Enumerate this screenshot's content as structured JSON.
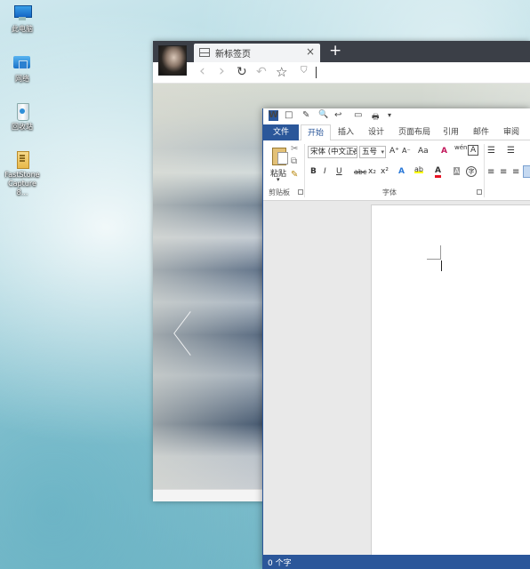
{
  "desktop": {
    "icons": [
      {
        "label": "此电脑",
        "icon": "this-pc-icon"
      },
      {
        "label": "网络",
        "icon": "network-icon"
      },
      {
        "label": "回收站",
        "icon": "recycle-bin-icon"
      },
      {
        "label": "FastStone Capture 8...",
        "icon": "faststone-capture-icon"
      }
    ]
  },
  "browser": {
    "tab_title": "新标签页",
    "tab_close": "×",
    "new_tab": "+",
    "nav": {
      "back": "‹",
      "forward": "›",
      "reload": "↻",
      "undo": "↶",
      "favorite": "☆"
    },
    "address_value": "",
    "slider_prev": "‹"
  },
  "word": {
    "quick_access": [
      "W",
      "□",
      "✎",
      "🔍",
      "↩",
      "▭",
      "🖶",
      "▾"
    ],
    "tabs": [
      "文件",
      "开始",
      "插入",
      "设计",
      "页面布局",
      "引用",
      "邮件",
      "审阅"
    ],
    "active_tab": "开始",
    "clipboard": {
      "paste_label": "粘贴",
      "group_label": "剪贴板"
    },
    "font": {
      "font_name": "宋体 (中文正文)",
      "font_size": "五号",
      "group_label": "字体",
      "buttons": {
        "grow": "A⁺",
        "shrink": "A⁻",
        "case": "Aa",
        "clear": "A",
        "phonetic": "wén",
        "border": "A",
        "bold": "B",
        "italic": "I",
        "underline": "U",
        "strike": "abc",
        "subscript": "x₂",
        "superscript": "x²",
        "effects": "A",
        "highlight": "ab",
        "color": "A",
        "shade": "A",
        "enclose": "字"
      }
    },
    "paragraph": {
      "bullets": "☰",
      "numbering": "☰"
    },
    "status": {
      "word_count": "0 个字"
    },
    "colors": {
      "accent": "#2b579a",
      "highlight": "#ffff00",
      "font_color": "#e81123"
    }
  }
}
